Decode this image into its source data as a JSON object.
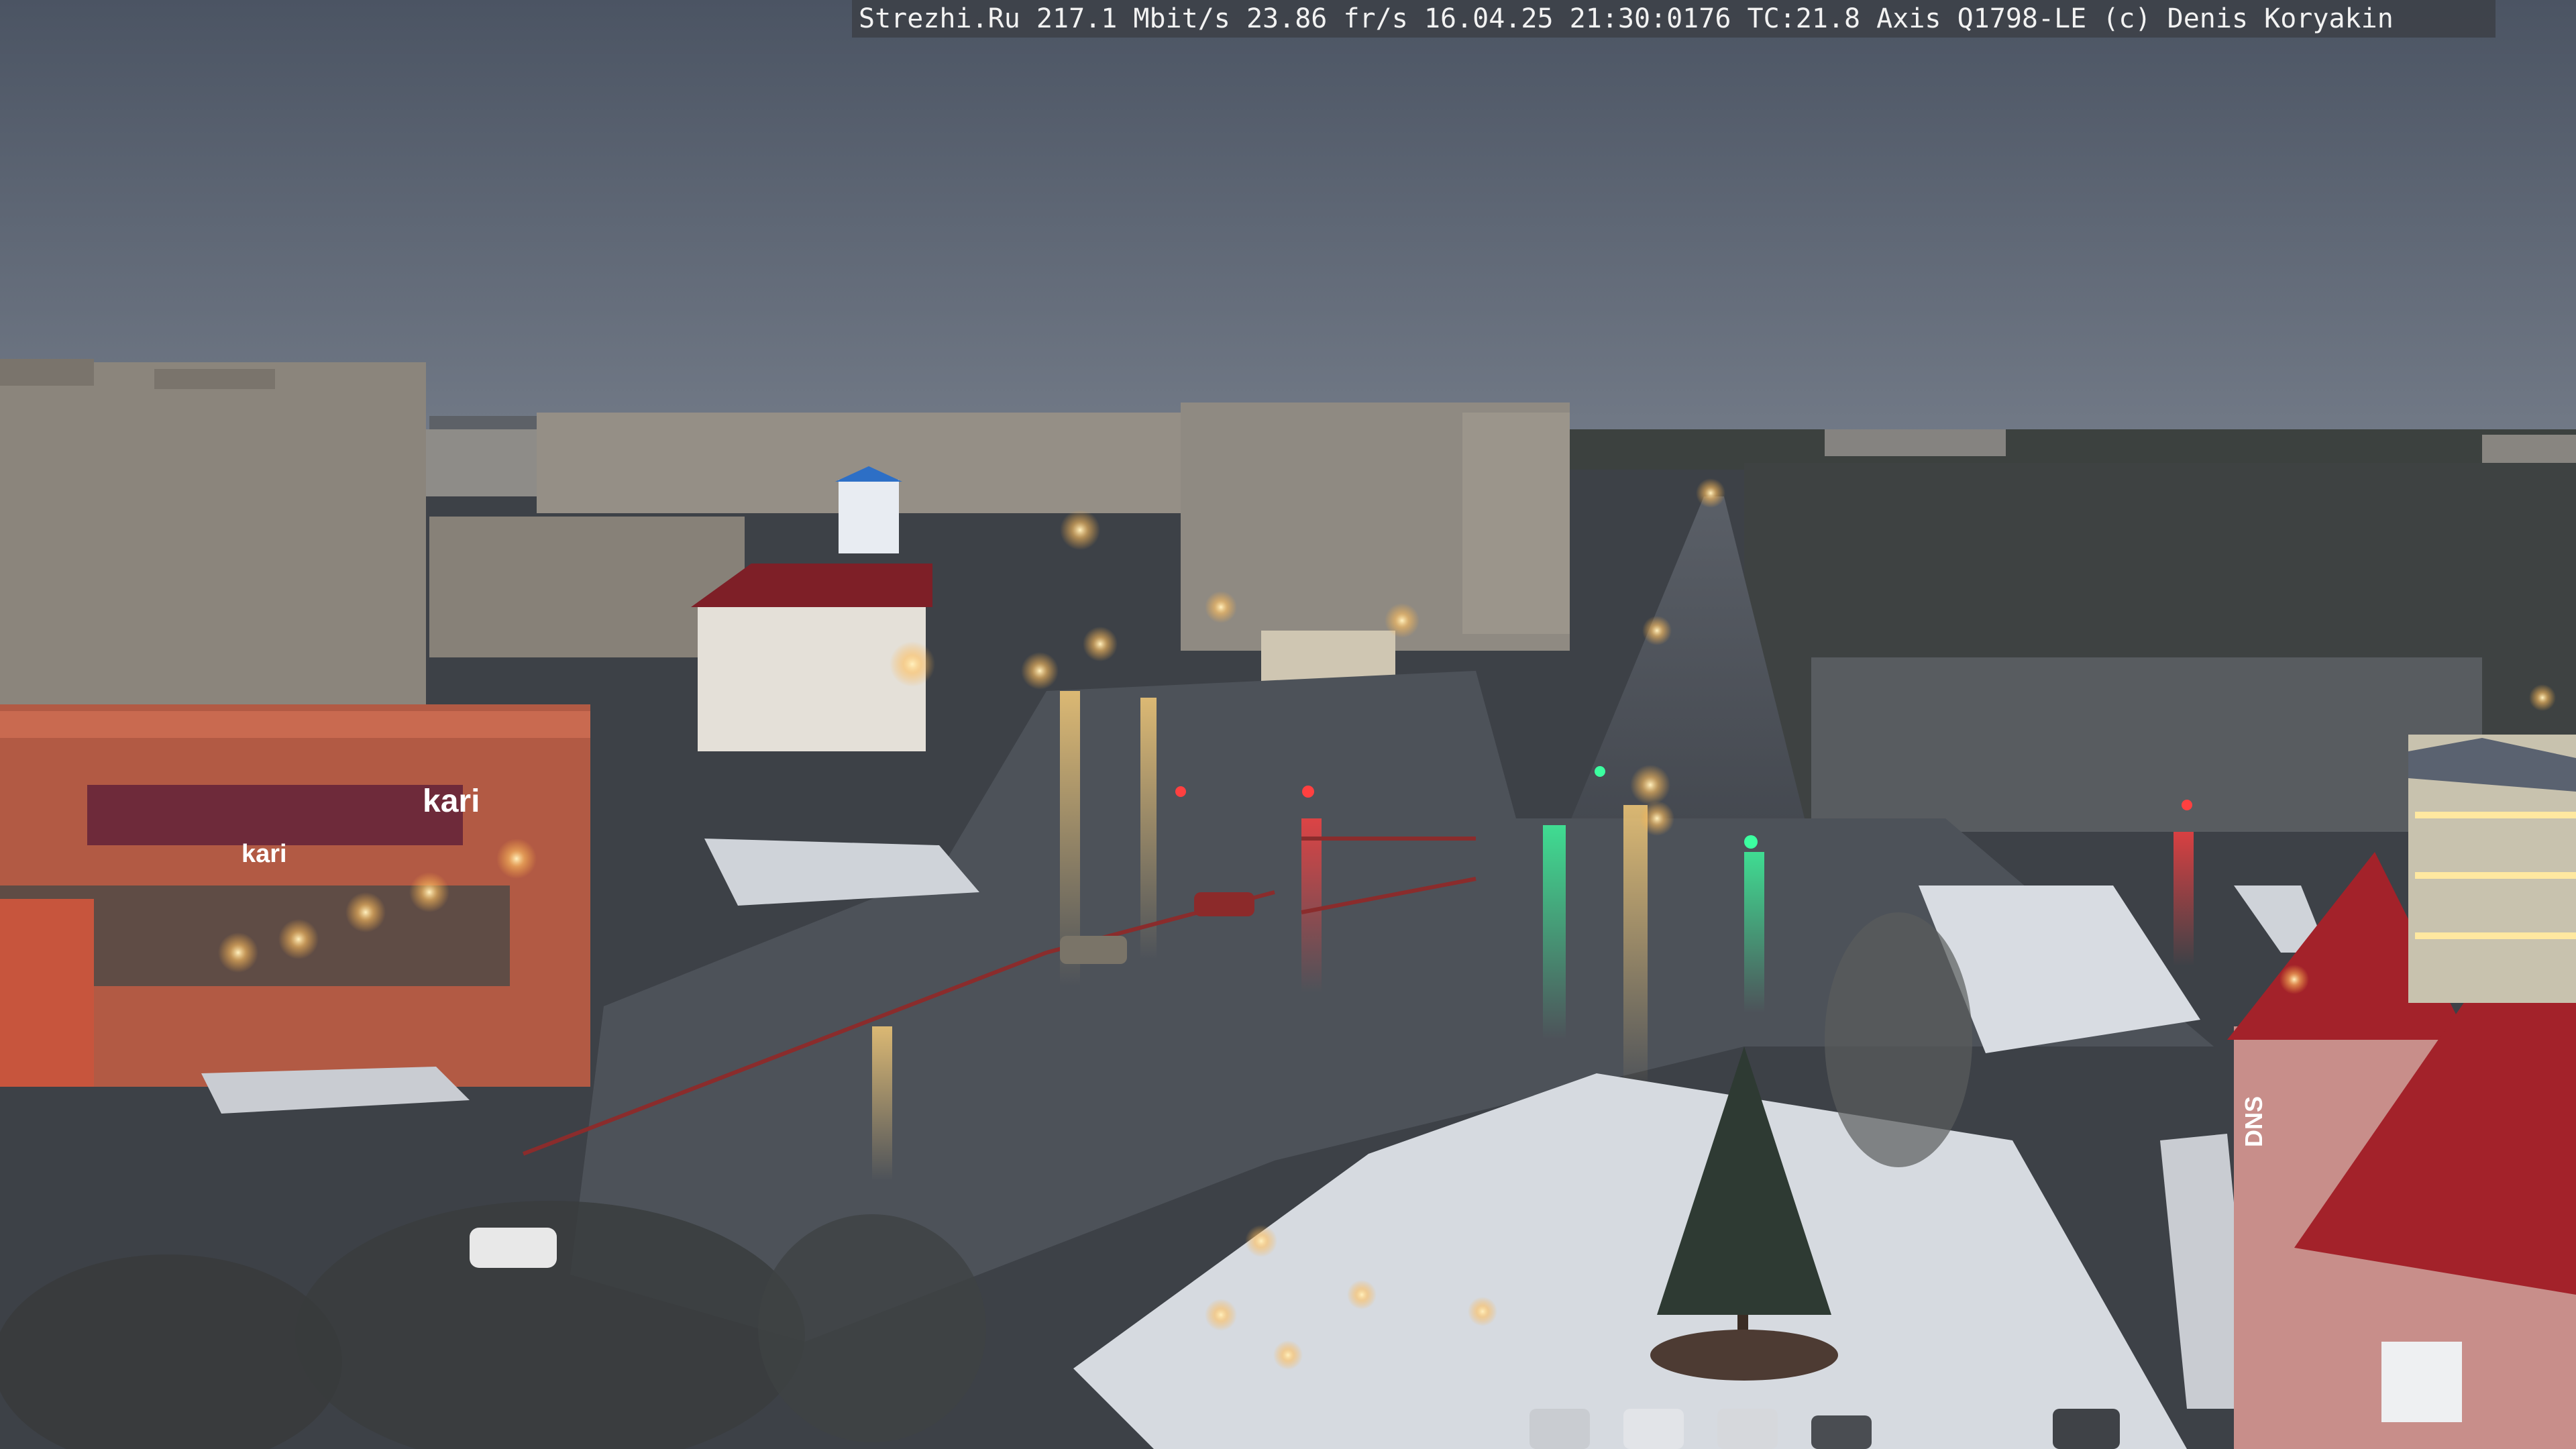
{
  "overlay": {
    "text": "Strezhi.Ru 217.1 Mbit/s 23.86 fr/s 16.04.25 21:30:0176 TC:21.8  Axis Q1798-LE  (c) Denis Koryakin"
  },
  "signs": {
    "kari": "kari",
    "store_right": "DNS"
  },
  "colors": {
    "sky_top": "#4e5766",
    "sky_bottom": "#6e7684",
    "road": "#4a4f57",
    "snow": "#d9dde3",
    "building_panel": "#8d8880",
    "mall_facade": "#b5553e",
    "roof_red": "#a8222b",
    "tree_dark": "#2f3431",
    "light_warm": "#ffd27a",
    "light_green": "#3cffa0",
    "light_red": "#ff4040"
  }
}
